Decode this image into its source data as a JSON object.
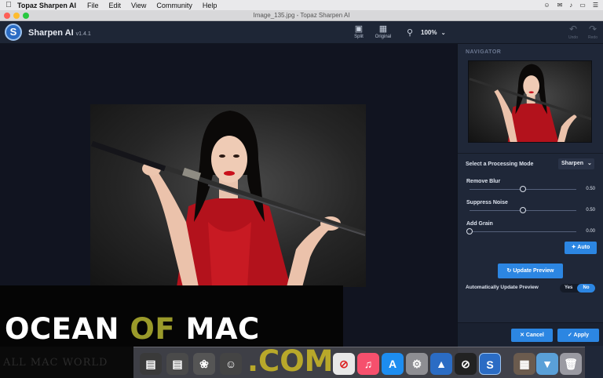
{
  "menubar": {
    "app_name": "Topaz Sharpen AI",
    "items": [
      "File",
      "Edit",
      "View",
      "Community",
      "Help"
    ]
  },
  "window": {
    "title": "Image_135.jpg - Topaz Sharpen AI"
  },
  "header": {
    "app_title": "Sharpen AI",
    "version": "v1.4.1",
    "split_label": "Split",
    "original_label": "Original",
    "zoom_value": "100%",
    "undo_label": "Undo",
    "redo_label": "Redo"
  },
  "panel": {
    "navigator_label": "NAVIGATOR",
    "mode_label": "Select a Processing Mode",
    "mode_value": "Sharpen",
    "sliders": [
      {
        "label": "Remove Blur",
        "value": "0.50",
        "level": 0.5
      },
      {
        "label": "Suppress Noise",
        "value": "0.50",
        "level": 0.5
      },
      {
        "label": "Add Grain",
        "value": "0.00",
        "level": 0.0
      }
    ],
    "auto_button": "Auto",
    "update_preview_button": "Update Preview",
    "auto_update_label": "Automatically Update Preview",
    "toggle_yes": "Yes",
    "toggle_no": "No",
    "cancel_button": "Cancel",
    "apply_button": "Apply"
  },
  "watermark": {
    "ocean": "OCEAN",
    "of": "OF",
    "mac": "MAC",
    "com": ".COM",
    "faded": "ALL MAC WORLD"
  },
  "colors": {
    "accent": "#2c86e2",
    "panel_bg": "#1f2738",
    "canvas_bg": "#111420"
  }
}
